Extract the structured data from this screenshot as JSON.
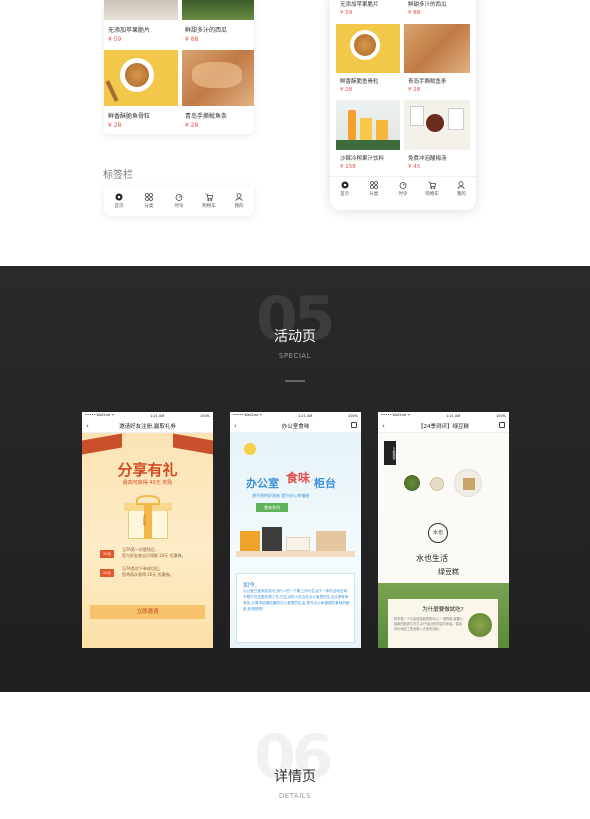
{
  "top": {
    "left_products": [
      {
        "name": "无添加苹果脆片",
        "price": "¥ 59"
      },
      {
        "name": "鲜甜多汁的西瓜",
        "price": "¥ 88"
      },
      {
        "name": "鲜香酥脆鱼骨粒",
        "price": "¥ 28"
      },
      {
        "name": "青岛手撕鱿鱼条",
        "price": "¥ 28"
      }
    ],
    "tabbar_label": "标签栏",
    "tabs": [
      {
        "label": "首页",
        "icon": "home-icon"
      },
      {
        "label": "分类",
        "icon": "category-icon"
      },
      {
        "label": "时令",
        "icon": "season-icon"
      },
      {
        "label": "购物车",
        "icon": "cart-icon"
      },
      {
        "label": "我的",
        "icon": "profile-icon"
      }
    ],
    "right_products": [
      {
        "name": "无添加苹果脆片",
        "price": "¥ 59"
      },
      {
        "name": "鲜甜多汁的西瓜",
        "price": "¥ 88"
      },
      {
        "name": "鲜香酥脆鱼骨粒",
        "price": "¥ 28"
      },
      {
        "name": "青岛手撕鱿鱼条",
        "price": "¥ 28"
      },
      {
        "name": "沙棘冷榨果汁饮料",
        "price": "¥ 158"
      },
      {
        "name": "免煮冲泡酸梅汤",
        "price": "¥ 45"
      }
    ]
  },
  "activity": {
    "number": "05",
    "title": "活动页",
    "subtitle": "SPECIAL",
    "screens": [
      {
        "status_left": "••••• WeChat ᯤ",
        "status_time": "1:21 AM",
        "status_right": "100%",
        "nav_title": "邀请好友注册,赢取礼券",
        "headline": "分享有礼",
        "subline": "最高可获得 40元 奖励",
        "gift_text": "大礼包",
        "coupon1_tag": "20元",
        "coupon1_text": "当TA第一次登陆后,\n您与好友各自可领取 20元 优惠券。",
        "coupon2_tag": "20元",
        "coupon2_text": "当TA首次下单成功后,\n您将再次获得 20元 优惠券。",
        "button": "立即邀请"
      },
      {
        "status_left": "••••• WeChat ᯤ",
        "status_time": "1:21 AM",
        "status_right": "100%",
        "nav_title": "办公室食味",
        "headline_a": "办公室",
        "headline_b": "食味",
        "headline_c": "柜台",
        "subline": "想不到的好滋味  提升办公幸福感",
        "series_btn": "食味系列",
        "product_box_text": "",
        "body_lead": "如今,",
        "body_text": "办公室已逐渐变成为当代人的一个集工作与生活于一体的活动空间。不限于在这里处理工作,在生活的人进当在办公室里的生活过得有声有色,让周末枯燥无趣的办公室里的生活,提升办公幸福感的食味的都被,赶快抢购!"
      },
      {
        "status_left": "••••• WeChat ᯤ",
        "status_time": "1:21 AM",
        "status_right": "100%",
        "nav_title": "【24季测评】绿豆糕",
        "seal_text": "24季测评",
        "brand_char": "水也",
        "headline_1": "水也生活",
        "headline_2": "绿豆糕",
        "card_title": "为什麼要做試吃?",
        "card_text": "科学表一个元素保持品质的中心,一道简单,就要以最新的品质与方式,对于最近的内容与体会。保持评价和加工的全新入大家来测评。"
      }
    ]
  },
  "details": {
    "number": "06",
    "title": "详情页",
    "subtitle": "DETAILS"
  },
  "colors": {
    "price_red": "#e8504d",
    "dark_bg": "#242424",
    "orange_accent": "#e5582c",
    "green_accent": "#5a8a3a",
    "blue_accent": "#3b8fd6"
  }
}
